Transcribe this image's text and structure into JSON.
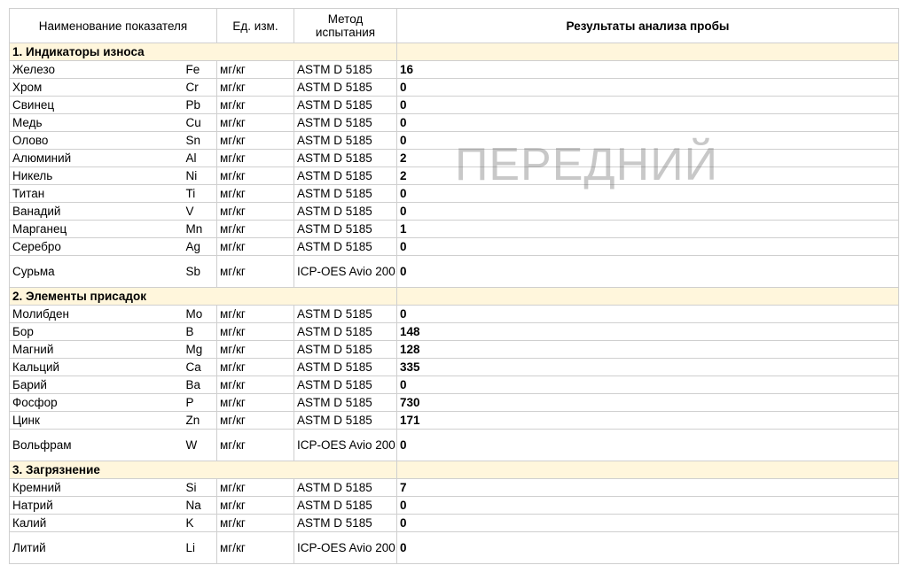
{
  "headers": {
    "name": "Наименование показателя",
    "unit": "Ед. изм.",
    "method": "Метод испытания",
    "result": "Результаты анализа пробы"
  },
  "sections": [
    {
      "title": "1. Индикаторы износа",
      "rows": [
        {
          "name": "Железо",
          "symbol": "Fe",
          "unit": "мг/кг",
          "method": "ASTM D 5185",
          "value": "16"
        },
        {
          "name": "Хром",
          "symbol": "Cr",
          "unit": "мг/кг",
          "method": "ASTM D 5185",
          "value": "0"
        },
        {
          "name": "Свинец",
          "symbol": "Pb",
          "unit": "мг/кг",
          "method": "ASTM D 5185",
          "value": "0"
        },
        {
          "name": "Медь",
          "symbol": "Cu",
          "unit": "мг/кг",
          "method": "ASTM D 5185",
          "value": "0"
        },
        {
          "name": "Олово",
          "symbol": "Sn",
          "unit": "мг/кг",
          "method": "ASTM D 5185",
          "value": "0"
        },
        {
          "name": "Алюминий",
          "symbol": "Al",
          "unit": "мг/кг",
          "method": "ASTM D 5185",
          "value": "2"
        },
        {
          "name": "Никель",
          "symbol": "Ni",
          "unit": "мг/кг",
          "method": "ASTM D 5185",
          "value": "2"
        },
        {
          "name": "Титан",
          "symbol": "Ti",
          "unit": "мг/кг",
          "method": "ASTM D 5185",
          "value": "0"
        },
        {
          "name": "Ванадий",
          "symbol": "V",
          "unit": "мг/кг",
          "method": "ASTM D 5185",
          "value": "0"
        },
        {
          "name": "Марганец",
          "symbol": "Mn",
          "unit": "мг/кг",
          "method": "ASTM D 5185",
          "value": "1"
        },
        {
          "name": "Серебро",
          "symbol": "Ag",
          "unit": "мг/кг",
          "method": "ASTM D 5185",
          "value": "0"
        },
        {
          "name": "Сурьма",
          "symbol": "Sb",
          "unit": "мг/кг",
          "method": "ICP-OES Avio 200",
          "value": "0"
        }
      ]
    },
    {
      "title": "2. Элементы присадок",
      "rows": [
        {
          "name": "Молибден",
          "symbol": "Mo",
          "unit": "мг/кг",
          "method": "ASTM D 5185",
          "value": "0"
        },
        {
          "name": "Бор",
          "symbol": "B",
          "unit": "мг/кг",
          "method": "ASTM D 5185",
          "value": "148"
        },
        {
          "name": "Магний",
          "symbol": "Mg",
          "unit": "мг/кг",
          "method": "ASTM D 5185",
          "value": "128"
        },
        {
          "name": "Кальций",
          "symbol": "Ca",
          "unit": "мг/кг",
          "method": "ASTM D 5185",
          "value": "335"
        },
        {
          "name": "Барий",
          "symbol": "Ba",
          "unit": "мг/кг",
          "method": "ASTM D 5185",
          "value": "0"
        },
        {
          "name": "Фосфор",
          "symbol": "P",
          "unit": "мг/кг",
          "method": "ASTM D 5185",
          "value": "730"
        },
        {
          "name": "Цинк",
          "symbol": "Zn",
          "unit": "мг/кг",
          "method": "ASTM D 5185",
          "value": "171"
        },
        {
          "name": "Вольфрам",
          "symbol": "W",
          "unit": "мг/кг",
          "method": "ICP-OES Avio 200",
          "value": "0"
        }
      ]
    },
    {
      "title": "3. Загрязнение",
      "rows": [
        {
          "name": "Кремний",
          "symbol": "Si",
          "unit": "мг/кг",
          "method": "ASTM D 5185",
          "value": "7"
        },
        {
          "name": "Натрий",
          "symbol": "Na",
          "unit": "мг/кг",
          "method": "ASTM D 5185",
          "value": "0"
        },
        {
          "name": "Калий",
          "symbol": "K",
          "unit": "мг/кг",
          "method": "ASTM D 5185",
          "value": "0"
        },
        {
          "name": "Литий",
          "symbol": "Li",
          "unit": "мг/кг",
          "method": "ICP-OES Avio 200",
          "value": "0"
        }
      ]
    }
  ],
  "watermark": "ПЕРЕДНИЙ",
  "colors": {
    "section_bg": "#fff6dc",
    "border": "#cfcfcf",
    "watermark": "#6e6e6e"
  }
}
